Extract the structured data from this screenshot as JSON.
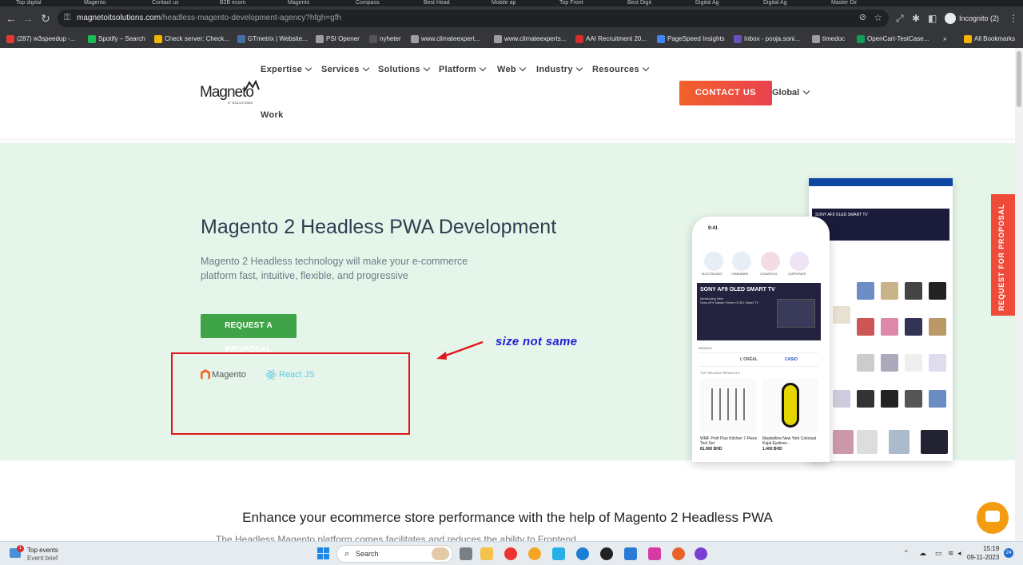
{
  "browser": {
    "tabs": [
      "Top digital",
      "Magento",
      "Contact us",
      "B2B ecom",
      "Magento",
      "Compass",
      "Best Head",
      "Mobile ap",
      "Top Front",
      "Best Digit",
      "Digital Ag",
      "Digital Ag",
      "Master Dir"
    ],
    "url_host": "magnetoitsolutions.com",
    "url_path": "/headless-magento-development-agency?hfgh=gfh",
    "profile_label": "Incognito (2)",
    "bookmarks": [
      {
        "label": "(287) w3speedup -...",
        "color": "#e53935"
      },
      {
        "label": "Spotify – Search",
        "color": "#1db954"
      },
      {
        "label": "Check server: Check...",
        "color": "#f4b400"
      },
      {
        "label": "GTmetrix | Website...",
        "color": "#4a6fa5"
      },
      {
        "label": "PSI Opener",
        "color": "#9e9e9e"
      },
      {
        "label": "nyheter",
        "color": "#555555"
      },
      {
        "label": "www.climateexpert...",
        "color": "#9e9e9e"
      },
      {
        "label": "www.climateexperts...",
        "color": "#9e9e9e"
      },
      {
        "label": "AAI Recruitment 20...",
        "color": "#d32f2f"
      },
      {
        "label": "PageSpeed Insights",
        "color": "#4285f4"
      },
      {
        "label": "Inbox - pooja.soni...",
        "color": "#6b4fbb"
      },
      {
        "label": "timedoc",
        "color": "#9e9e9e"
      },
      {
        "label": "OpenCart-TestCase...",
        "color": "#0f9d58"
      }
    ],
    "more_bookmarks": "»",
    "all_bookmarks": "All Bookmarks"
  },
  "site": {
    "logo_text": "Magneto",
    "logo_sub": "IT SOLUTIONS",
    "menu": [
      "Expertise",
      "Services",
      "Solutions",
      "Platform",
      "Web",
      "Industry",
      "Resources"
    ],
    "menu_work": "Work",
    "contact_label": "CONTACT US",
    "global_label": "Global"
  },
  "hero": {
    "title": "Magento 2 Headless PWA Development",
    "description": "Magento 2 Headless technology will make your e-commerce platform fast, intuitive, flexible, and progressive",
    "cta_label": "REQUEST A PROPOSAL",
    "tech_1": "Magento",
    "tech_2": "React JS",
    "annotation": "size not same"
  },
  "mockup": {
    "phone_time": "9:41",
    "categories": [
      "ELECTRONICS",
      "HOMEWARE",
      "COSMETICS",
      "CORPORATE"
    ],
    "banner_title": "SONY AF9 OLED SMART TV",
    "banner_sub1": "Introducing New",
    "banner_sub2": "Sony AF9 Master Series OLED Smart TV",
    "brands_label": "BRANDS",
    "brands": [
      "L'ORÉAL",
      "CASIO"
    ],
    "top_selling": "TOP SELLING PRODUCTS",
    "products": [
      {
        "name": "WMF Profi Plus Kitchen 7-Piece Tool Set",
        "price": "81.900 BHD"
      },
      {
        "name": "Maybelline New York Colossal Kajal Eyeliner...",
        "price": "1.400 BHD"
      }
    ],
    "desktop_banner": "SONY AF9 OLED SMART TV"
  },
  "side_tab": "REQUEST FOR PROPOSAL",
  "section2": {
    "title": "Enhance your ecommerce store performance with the help of Magento 2 Headless PWA",
    "subtitle": "The Headless Magento platform comes facilitates and reduces the ability to Frontend"
  },
  "taskbar": {
    "weather_title": "Top events",
    "weather_sub": "Event brief",
    "weather_badge": "1",
    "search_label": "Search",
    "time": "15:19",
    "date": "09-11-2023",
    "notif_count": "24"
  }
}
